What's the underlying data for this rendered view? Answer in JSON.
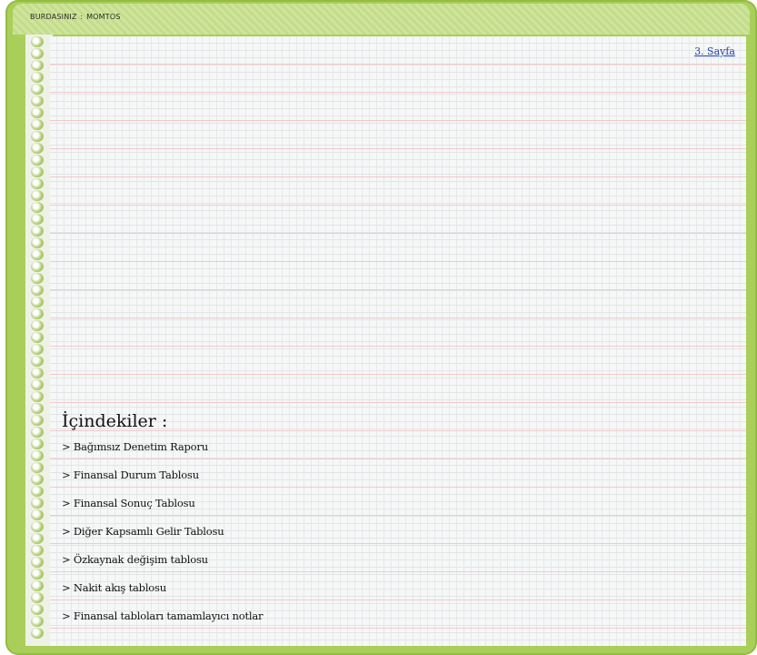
{
  "breadcrumb": {
    "label": "BURDASINIZ",
    "separator": ":",
    "current": "MOMTOS"
  },
  "page_link": "3. Sayfa",
  "toc": {
    "title": "İçindekiler :",
    "items": [
      "> Bağımsız Denetim Raporu",
      "> Finansal Durum Tablosu",
      "> Finansal Sonuç Tablosu",
      "> Diğer Kapsamlı Gelir Tablosu",
      "> Özkaynak değişim tablosu",
      "> Nakit akış tablosu",
      "> Finansal tabloları tamamlayıcı notlar"
    ]
  },
  "colors": {
    "frame": "#a9cf5a",
    "ruled_line": "#f2c9cc",
    "link": "#2244aa"
  }
}
